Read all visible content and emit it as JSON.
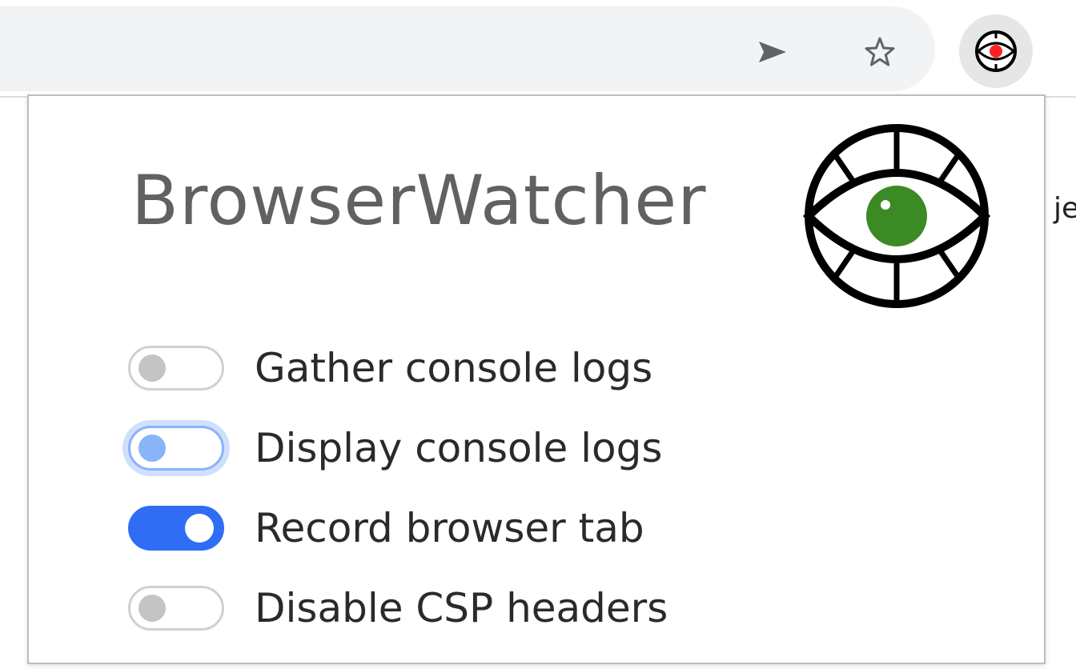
{
  "toolbar": {
    "share_icon": "send-arrow-icon",
    "bookmark_icon": "star-outline-icon",
    "extension_icon": "browserwatcher-eye-icon"
  },
  "page": {
    "partial_text": "je"
  },
  "popup": {
    "title": "BrowserWatcher",
    "logo_icon": "eye-logo-icon",
    "options": [
      {
        "label": "Gather console logs",
        "state": "off"
      },
      {
        "label": "Display console logs",
        "state": "off-focused"
      },
      {
        "label": "Record browser tab",
        "state": "on"
      },
      {
        "label": "Disable CSP headers",
        "state": "off"
      }
    ]
  },
  "colors": {
    "toggle_on": "#2f6df5",
    "toggle_focus": "#8ab4f8",
    "toggle_off_knob": "#c4c4c4",
    "title_text": "#616161",
    "logo_iris": "#3b8a23",
    "extension_dot": "#ff2020"
  }
}
